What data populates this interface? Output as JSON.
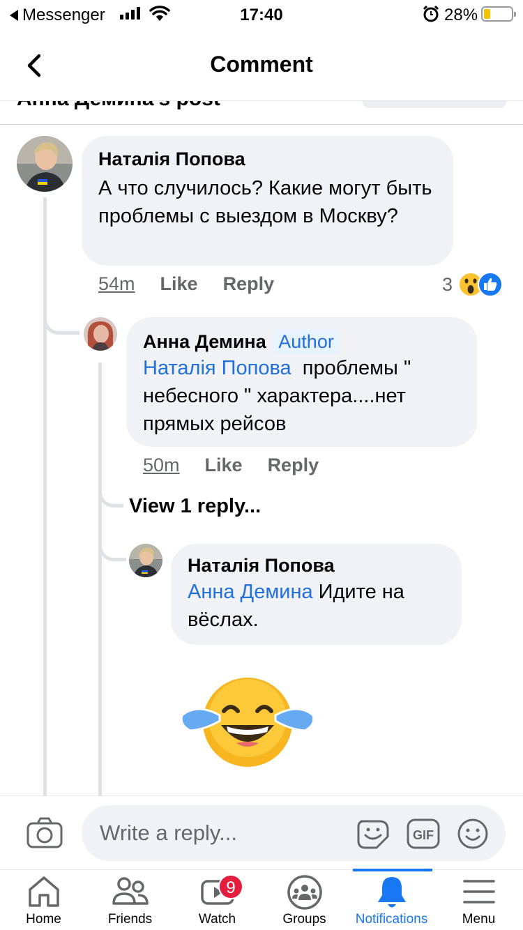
{
  "status_bar": {
    "back_app": "Messenger",
    "time": "17:40",
    "battery": "28%"
  },
  "header": {
    "title": "Comment",
    "peek_text": "Анна Демина's post"
  },
  "comment": {
    "author": "Наталія Попова",
    "text": "А что случилось? Какие могут быть проблемы с выездом в Москву?",
    "time": "54m",
    "like_label": "Like",
    "reply_label": "Reply",
    "reaction_count": "3"
  },
  "reply1": {
    "author": "Анна Демина",
    "badge": "Author",
    "mention": "Наталія Попова",
    "text": "  проблемы \" небесного \" характера....нет прямых рейсов",
    "time": "50m",
    "like_label": "Like",
    "reply_label": "Reply"
  },
  "view_replies": "View 1 reply...",
  "reply2": {
    "author": "Наталія Попова",
    "mention": "Анна Демина",
    "text": " Идите на вёслах."
  },
  "composer": {
    "placeholder": "Write a reply..."
  },
  "tabs": [
    {
      "label": "Home",
      "icon": "home-icon"
    },
    {
      "label": "Friends",
      "icon": "friends-icon"
    },
    {
      "label": "Watch",
      "icon": "watch-icon"
    },
    {
      "label": "Groups",
      "icon": "groups-icon"
    },
    {
      "label": "Notifications",
      "icon": "bell-icon"
    },
    {
      "label": "Menu",
      "icon": "menu-icon"
    }
  ],
  "watch_badge": "9",
  "colors": {
    "accent": "#1877f2",
    "mention": "#216fdb",
    "bubble": "#f0f2f5",
    "badge": "#e41e3f"
  }
}
